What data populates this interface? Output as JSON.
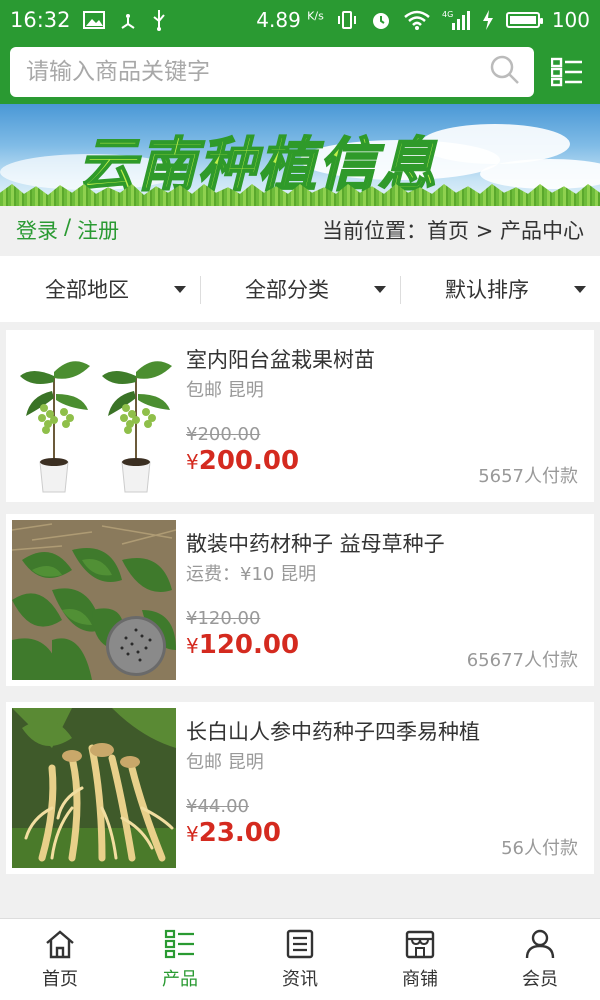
{
  "status_bar": {
    "time": "16:32",
    "net_speed": "4.89",
    "net_unit": "K/s",
    "battery": "100",
    "icons": [
      "image-icon",
      "usb-icon",
      "vibrate-icon",
      "alarm-icon",
      "wifi-icon",
      "signal-4g-icon",
      "charging-icon",
      "battery-icon"
    ]
  },
  "search": {
    "placeholder": "请输入商品关键字",
    "value": ""
  },
  "banner": {
    "title": "云南种植信息"
  },
  "account": {
    "login": "登录",
    "separator": "/",
    "register": "注册"
  },
  "breadcrumb": {
    "text": "当前位置：首页 > 产品中心"
  },
  "filters": [
    {
      "label": "全部地区"
    },
    {
      "label": "全部分类"
    },
    {
      "label": "默认排序"
    }
  ],
  "products": [
    {
      "title": "室内阳台盆栽果树苗",
      "meta": "包邮 昆明",
      "old_price": "¥200.00",
      "currency": "¥",
      "price": "200.00",
      "sold": "5657人付款",
      "image": "potted-grape-seedling"
    },
    {
      "title": "散装中药材种子 益母草种子",
      "meta": "运费：¥10 昆明",
      "old_price": "¥120.00",
      "currency": "¥",
      "price": "120.00",
      "sold": "65677人付款",
      "image": "motherwort-seeds"
    },
    {
      "title": "长白山人参中药种子四季易种植",
      "meta": "包邮 昆明",
      "old_price": "¥44.00",
      "currency": "¥",
      "price": "23.00",
      "sold": "56人付款",
      "image": "ginseng-roots"
    }
  ],
  "bottom_nav": [
    {
      "label": "首页",
      "icon": "home-icon",
      "active": false
    },
    {
      "label": "产品",
      "icon": "product-grid-icon",
      "active": true
    },
    {
      "label": "资讯",
      "icon": "news-icon",
      "active": false
    },
    {
      "label": "商铺",
      "icon": "shop-icon",
      "active": false
    },
    {
      "label": "会员",
      "icon": "user-icon",
      "active": false
    }
  ],
  "colors": {
    "brand_green": "#2a9a32",
    "price_red": "#d42a1f",
    "muted_text": "#999999"
  }
}
